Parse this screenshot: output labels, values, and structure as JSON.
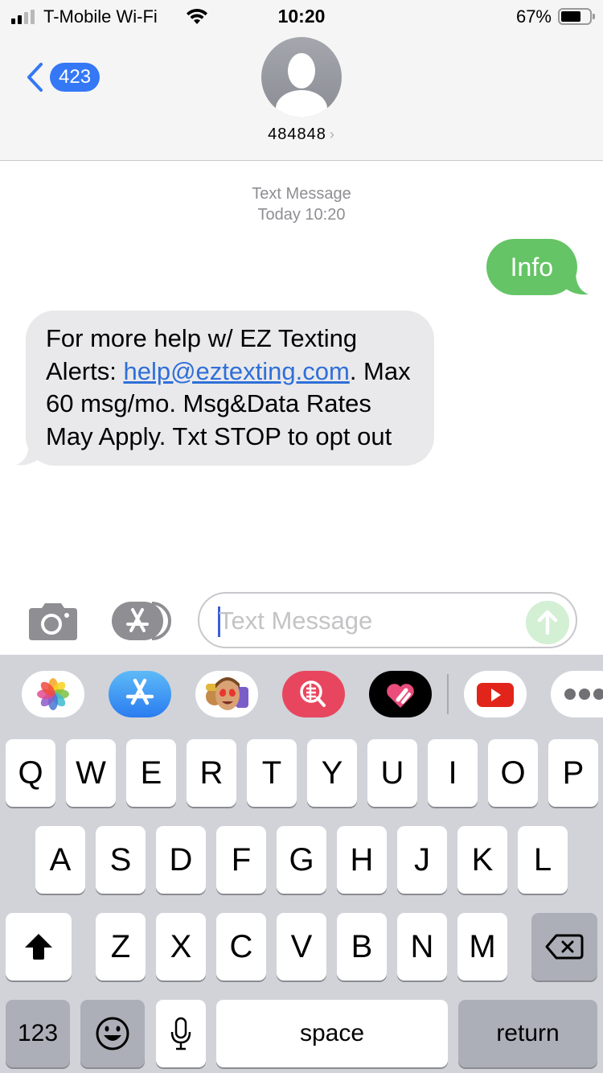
{
  "status_bar": {
    "carrier": "T-Mobile Wi-Fi",
    "time": "10:20",
    "battery_percent": "67%",
    "signal_bars_active": 2,
    "signal_bars_total": 4,
    "battery_level": 0.67
  },
  "header": {
    "back_badge_count": "423",
    "contact_name": "484848",
    "contact_chevron": "›"
  },
  "conversation": {
    "meta_title": "Text Message",
    "meta_timestamp": "Today 10:20",
    "messages": [
      {
        "direction": "outgoing",
        "text": "Info",
        "color": "#65c466"
      },
      {
        "direction": "incoming",
        "text_before": "For more help w/ EZ Texting Alerts: ",
        "link": "help@eztexting.com",
        "text_after": ". Max 60 msg/mo. Msg&Data Rates May Apply. Txt STOP to opt out",
        "color": "#e9e9eb"
      }
    ]
  },
  "input_bar": {
    "placeholder": "Text Message",
    "value": ""
  },
  "app_strip": {
    "apps": [
      {
        "name": "Photos",
        "icon": "photos-icon"
      },
      {
        "name": "App Store",
        "icon": "app-store-icon"
      },
      {
        "name": "Memoji Stickers",
        "icon": "memoji-icon"
      },
      {
        "name": "Web Image Search",
        "icon": "image-search-icon"
      },
      {
        "name": "Digital Touch",
        "icon": "digital-touch-icon"
      },
      {
        "name": "YouTube",
        "icon": "youtube-icon"
      },
      {
        "name": "More",
        "icon": "more-icon"
      }
    ]
  },
  "keyboard": {
    "row1": [
      "Q",
      "W",
      "E",
      "R",
      "T",
      "Y",
      "U",
      "I",
      "O",
      "P"
    ],
    "row2": [
      "A",
      "S",
      "D",
      "F",
      "G",
      "H",
      "J",
      "K",
      "L"
    ],
    "row3": [
      "Z",
      "X",
      "C",
      "V",
      "B",
      "N",
      "M"
    ],
    "numbers_label": "123",
    "space_label": "space",
    "return_label": "return"
  }
}
